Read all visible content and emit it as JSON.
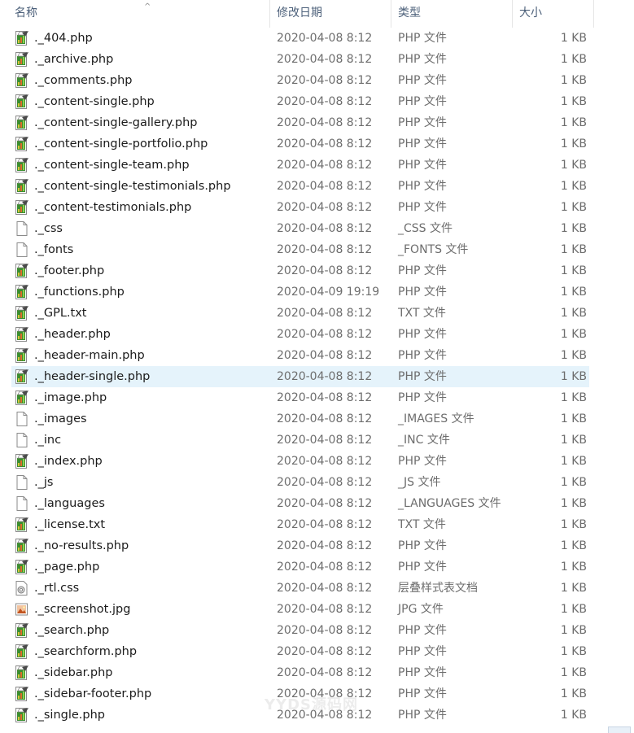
{
  "columns": {
    "name": "名称",
    "date": "修改日期",
    "type": "类型",
    "size": "大小"
  },
  "selected_index": 16,
  "watermark": "YYDS源码网",
  "files": [
    {
      "name": "._404.php",
      "date": "2020-04-08 8:12",
      "type": "PHP 文件",
      "size": "1 KB",
      "icon": "php-file-icon"
    },
    {
      "name": "._archive.php",
      "date": "2020-04-08 8:12",
      "type": "PHP 文件",
      "size": "1 KB",
      "icon": "php-file-icon"
    },
    {
      "name": "._comments.php",
      "date": "2020-04-08 8:12",
      "type": "PHP 文件",
      "size": "1 KB",
      "icon": "php-file-icon"
    },
    {
      "name": "._content-single.php",
      "date": "2020-04-08 8:12",
      "type": "PHP 文件",
      "size": "1 KB",
      "icon": "php-file-icon"
    },
    {
      "name": "._content-single-gallery.php",
      "date": "2020-04-08 8:12",
      "type": "PHP 文件",
      "size": "1 KB",
      "icon": "php-file-icon"
    },
    {
      "name": "._content-single-portfolio.php",
      "date": "2020-04-08 8:12",
      "type": "PHP 文件",
      "size": "1 KB",
      "icon": "php-file-icon"
    },
    {
      "name": "._content-single-team.php",
      "date": "2020-04-08 8:12",
      "type": "PHP 文件",
      "size": "1 KB",
      "icon": "php-file-icon"
    },
    {
      "name": "._content-single-testimonials.php",
      "date": "2020-04-08 8:12",
      "type": "PHP 文件",
      "size": "1 KB",
      "icon": "php-file-icon"
    },
    {
      "name": "._content-testimonials.php",
      "date": "2020-04-08 8:12",
      "type": "PHP 文件",
      "size": "1 KB",
      "icon": "php-file-icon"
    },
    {
      "name": "._css",
      "date": "2020-04-08 8:12",
      "type": "_CSS 文件",
      "size": "1 KB",
      "icon": "blank-file-icon"
    },
    {
      "name": "._fonts",
      "date": "2020-04-08 8:12",
      "type": "_FONTS 文件",
      "size": "1 KB",
      "icon": "blank-file-icon"
    },
    {
      "name": "._footer.php",
      "date": "2020-04-08 8:12",
      "type": "PHP 文件",
      "size": "1 KB",
      "icon": "php-file-icon"
    },
    {
      "name": "._functions.php",
      "date": "2020-04-09 19:19",
      "type": "PHP 文件",
      "size": "1 KB",
      "icon": "php-file-icon"
    },
    {
      "name": "._GPL.txt",
      "date": "2020-04-08 8:12",
      "type": "TXT 文件",
      "size": "1 KB",
      "icon": "php-file-icon"
    },
    {
      "name": "._header.php",
      "date": "2020-04-08 8:12",
      "type": "PHP 文件",
      "size": "1 KB",
      "icon": "php-file-icon"
    },
    {
      "name": "._header-main.php",
      "date": "2020-04-08 8:12",
      "type": "PHP 文件",
      "size": "1 KB",
      "icon": "php-file-icon"
    },
    {
      "name": "._header-single.php",
      "date": "2020-04-08 8:12",
      "type": "PHP 文件",
      "size": "1 KB",
      "icon": "php-file-icon"
    },
    {
      "name": "._image.php",
      "date": "2020-04-08 8:12",
      "type": "PHP 文件",
      "size": "1 KB",
      "icon": "php-file-icon"
    },
    {
      "name": "._images",
      "date": "2020-04-08 8:12",
      "type": "_IMAGES 文件",
      "size": "1 KB",
      "icon": "blank-file-icon"
    },
    {
      "name": "._inc",
      "date": "2020-04-08 8:12",
      "type": "_INC 文件",
      "size": "1 KB",
      "icon": "blank-file-icon"
    },
    {
      "name": "._index.php",
      "date": "2020-04-08 8:12",
      "type": "PHP 文件",
      "size": "1 KB",
      "icon": "php-file-icon"
    },
    {
      "name": "._js",
      "date": "2020-04-08 8:12",
      "type": "_JS 文件",
      "size": "1 KB",
      "icon": "blank-file-icon"
    },
    {
      "name": "._languages",
      "date": "2020-04-08 8:12",
      "type": "_LANGUAGES 文件",
      "size": "1 KB",
      "icon": "blank-file-icon"
    },
    {
      "name": "._license.txt",
      "date": "2020-04-08 8:12",
      "type": "TXT 文件",
      "size": "1 KB",
      "icon": "php-file-icon"
    },
    {
      "name": "._no-results.php",
      "date": "2020-04-08 8:12",
      "type": "PHP 文件",
      "size": "1 KB",
      "icon": "php-file-icon"
    },
    {
      "name": "._page.php",
      "date": "2020-04-08 8:12",
      "type": "PHP 文件",
      "size": "1 KB",
      "icon": "php-file-icon"
    },
    {
      "name": "._rtl.css",
      "date": "2020-04-08 8:12",
      "type": "层叠样式表文档",
      "size": "1 KB",
      "icon": "css-file-icon"
    },
    {
      "name": "._screenshot.jpg",
      "date": "2020-04-08 8:12",
      "type": "JPG 文件",
      "size": "1 KB",
      "icon": "image-file-icon"
    },
    {
      "name": "._search.php",
      "date": "2020-04-08 8:12",
      "type": "PHP 文件",
      "size": "1 KB",
      "icon": "php-file-icon"
    },
    {
      "name": "._searchform.php",
      "date": "2020-04-08 8:12",
      "type": "PHP 文件",
      "size": "1 KB",
      "icon": "php-file-icon"
    },
    {
      "name": "._sidebar.php",
      "date": "2020-04-08 8:12",
      "type": "PHP 文件",
      "size": "1 KB",
      "icon": "php-file-icon"
    },
    {
      "name": "._sidebar-footer.php",
      "date": "2020-04-08 8:12",
      "type": "PHP 文件",
      "size": "1 KB",
      "icon": "php-file-icon"
    },
    {
      "name": "._single.php",
      "date": "2020-04-08 8:12",
      "type": "PHP 文件",
      "size": "1 KB",
      "icon": "php-file-icon"
    }
  ]
}
